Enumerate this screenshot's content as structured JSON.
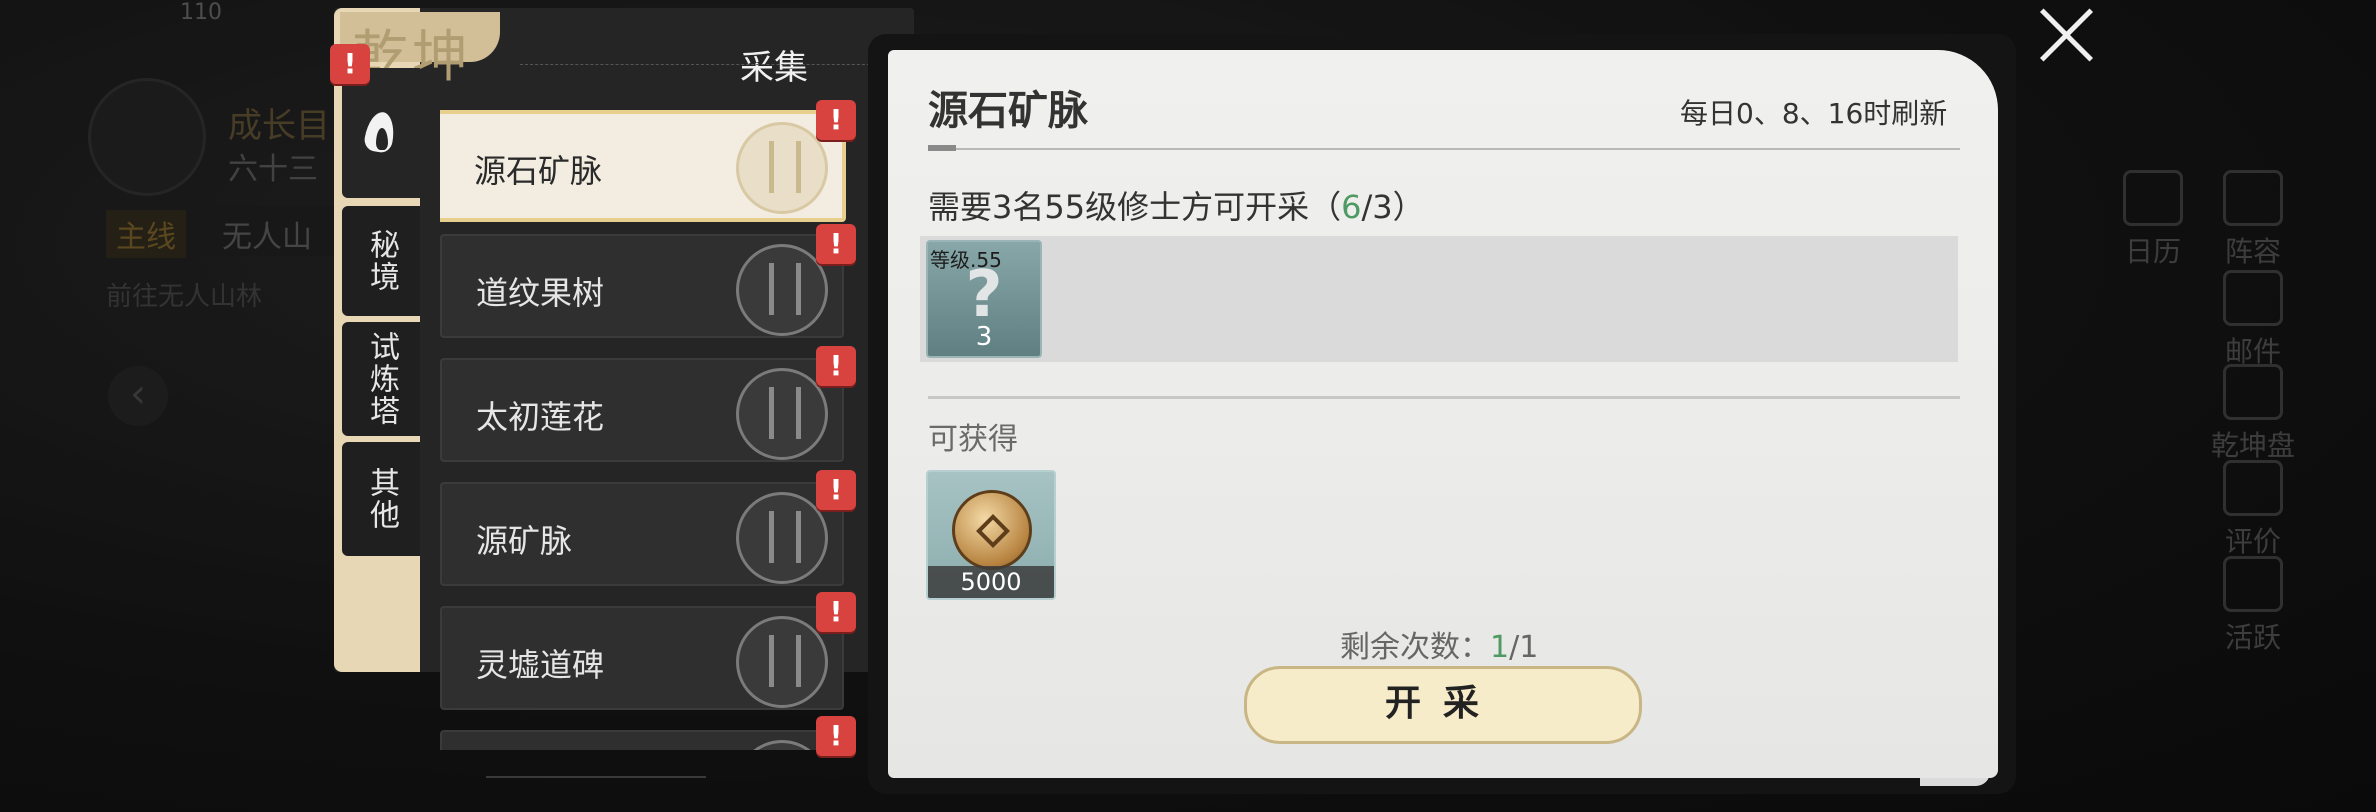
{
  "background": {
    "level": "110",
    "player_title": "成长目",
    "player_sub": "六十三",
    "task_tag": "主线",
    "task_text": "无人山",
    "task_desc": "前往无人山林",
    "side_buttons": [
      "日历",
      "阵容",
      "邮件",
      "乾坤盘",
      "评价",
      "活跃"
    ]
  },
  "left_panel": {
    "header_bg_text": "乾坤",
    "title": "采集",
    "tabs": [
      "秘境",
      "试炼塔",
      "其他"
    ],
    "items": [
      {
        "label": "源石矿脉",
        "selected": true
      },
      {
        "label": "道纹果树",
        "selected": false
      },
      {
        "label": "太初莲花",
        "selected": false
      },
      {
        "label": "源矿脉",
        "selected": false
      },
      {
        "label": "灵墟道碑",
        "selected": false
      },
      {
        "label": "",
        "selected": false
      }
    ],
    "alert_symbol": "!"
  },
  "detail": {
    "title": "源石矿脉",
    "refresh": "每日0、8、16时刷新",
    "requirement_prefix": "需要3名55级修士方可开采（",
    "requirement_current": "6",
    "requirement_suffix": "/3）",
    "slot": {
      "level": "等级.55",
      "symbol": "?",
      "count": "3"
    },
    "obtain_label": "可获得",
    "reward": {
      "icon": "coin-icon",
      "value": "5000"
    },
    "remaining_label": "剩余次数：",
    "remaining_current": "1",
    "remaining_suffix": "/1",
    "start_button": "开采"
  },
  "colors": {
    "accent_green": "#4f9a62",
    "alert_red": "#d8433f",
    "beige": "#e8d7b4"
  }
}
